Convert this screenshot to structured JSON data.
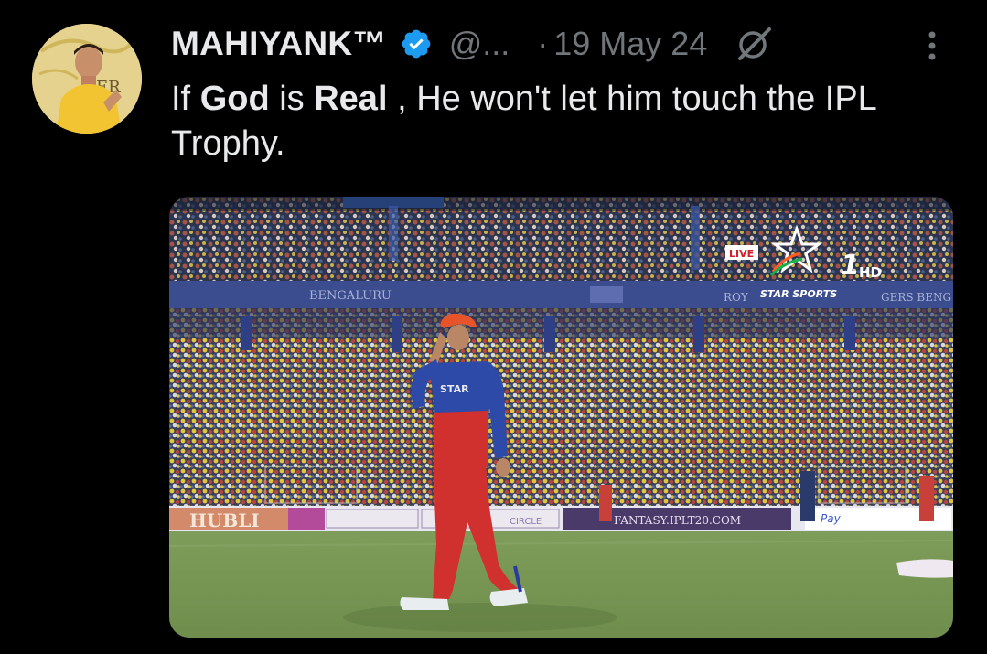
{
  "author": {
    "display_name": "MAHIYANK™",
    "handle": "@...",
    "verified_icon": "verified-badge-icon",
    "avatar_icon": "profile-avatar"
  },
  "meta": {
    "separator": "·",
    "date": "19 May 24"
  },
  "tweet": {
    "parts": [
      {
        "text": "If ",
        "bold": false
      },
      {
        "text": "God",
        "bold": true
      },
      {
        "text": " is ",
        "bold": false
      },
      {
        "text": "Real",
        "bold": true
      },
      {
        "text": " , He won't let him touch the IPL Trophy.",
        "bold": false
      }
    ]
  },
  "media": {
    "broadcast_live": "LIVE",
    "broadcast_channel": "1",
    "broadcast_hd": "HD",
    "broadcast_network": "STAR SPORTS",
    "banner_left": "BENGALURU",
    "banner_right_partial": "ROY",
    "banner_right_partial2": "GERS BENG",
    "board_hubli": "HUBLI",
    "board_circle": "CIRCLE",
    "board_fantasy": "FANTASY.IPLT20.COM",
    "board_pay": "Pay",
    "jersey_text": "STAR"
  },
  "colors": {
    "accent_verified": "#1d9bf0",
    "text_primary": "#e7e9ea",
    "text_secondary": "#71767b",
    "background": "#000000"
  }
}
